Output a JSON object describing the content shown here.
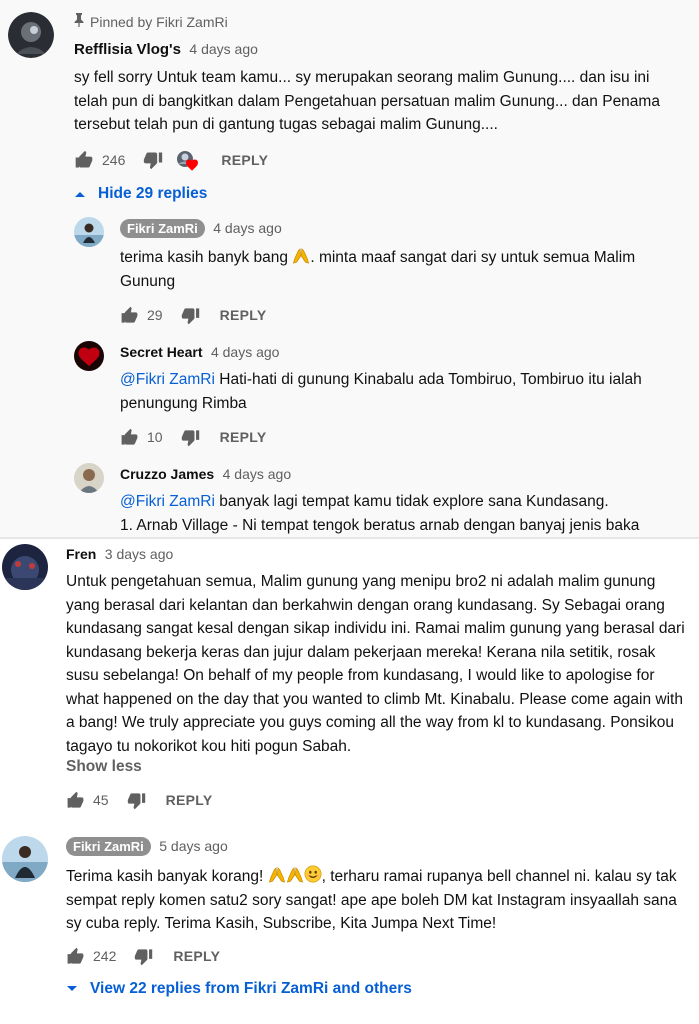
{
  "thread1": {
    "pinned_label": "Pinned by Fikri ZamRi",
    "author": "Refflisia Vlog's",
    "date": "4 days ago",
    "text": "sy fell sorry Untuk team kamu... sy merupakan seorang malim Gunung.... dan isu ini telah pun di bangkitkan dalam Pengetahuan persatuan malim Gunung... dan Penama tersebut telah pun di gantung tugas sebagai malim Gunung....",
    "likes": "246",
    "reply_label": "REPLY",
    "hide_replies": "Hide 29 replies"
  },
  "replies": [
    {
      "author": "Fikri ZamRi",
      "date": "4 days ago",
      "text_a": "terima kasih banyk bang ",
      "text_b": ". minta maaf sangat dari sy untuk semua Malim Gunung",
      "likes": "29",
      "reply_label": "REPLY"
    },
    {
      "author": "Secret Heart",
      "date": "4 days ago",
      "mention": "@Fikri ZamRi",
      "text": " Hati-hati di gunung Kinabalu ada Tombiruo, Tombiruo itu ialah penungung Rimba",
      "likes": "10",
      "reply_label": "REPLY"
    },
    {
      "author": "Cruzzo James",
      "date": "4 days ago",
      "mention": "@Fikri ZamRi",
      "text_a": " banyak lagi tempat kamu tidak explore sana Kundasang.",
      "text_b": "1. Arnab Village - Ni tempat tengok beratus arnab dengan banyaj jenis baka"
    }
  ],
  "thread2": {
    "author": "Fren",
    "date": "3 days ago",
    "text": "Untuk pengetahuan semua, Malim gunung yang menipu bro2 ni adalah malim gunung yang berasal dari kelantan dan berkahwin dengan orang kundasang. Sy Sebagai orang kundasang sangat kesal dengan sikap individu ini. Ramai malim gunung yang berasal dari kundasang bekerja keras dan jujur dalam pekerjaan mereka! Kerana nila setitik, rosak susu sebelanga! On behalf of my people from kundasang, I would like to apologise for what happened on the day that you wanted to climb Mt. Kinabalu. Please come again with a bang! We truly appreciate you guys coming all the way from kl to kundasang. Ponsikou tagayo tu nokorikot kou hiti pogun Sabah.",
    "show_less": "Show less",
    "likes": "45",
    "reply_label": "REPLY"
  },
  "thread3": {
    "author": "Fikri ZamRi",
    "date": "5 days ago",
    "text_a": "Terima kasih banyak korang! ",
    "text_b": ", terharu ramai rupanya bell channel ni. kalau sy tak sempat reply komen satu2 sory sangat! ape ape boleh DM kat Instagram insyaallah sana sy cuba reply. Terima Kasih, Subscribe, Kita Jumpa Next Time!",
    "likes": "242",
    "reply_label": "REPLY",
    "view_replies": "View 22 replies from Fikri ZamRi and others"
  },
  "icons": {
    "like": "thumb-up-icon",
    "dislike": "thumb-down-icon",
    "pin": "pin-icon",
    "heart": "creator-heart-icon",
    "collapse": "chevron-up-icon",
    "expand": "chevron-down-icon",
    "pray": "folded-hands-emoji",
    "smile": "smile-emoji"
  },
  "colors": {
    "link": "#065fd4",
    "meta": "#606060",
    "heart": "#ff0000",
    "chip": "#8f8f8f"
  }
}
